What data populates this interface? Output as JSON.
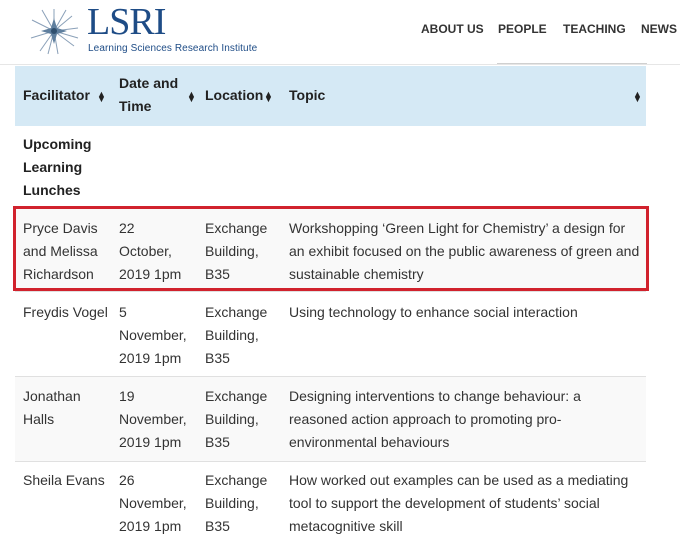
{
  "logo": {
    "title": "LSRI",
    "subtitle": "Learning Sciences Research Institute"
  },
  "nav": [
    "ABOUT US",
    "PEOPLE",
    "TEACHING",
    "NEWS"
  ],
  "table": {
    "headers": {
      "facilitator": "Facilitator",
      "date_time_1": "Date and",
      "date_time_2": "Time",
      "location": "Location",
      "topic": "Topic"
    },
    "group": [
      "Upcoming",
      "Learning",
      "Lunches"
    ],
    "rows": [
      {
        "facilitator": [
          "Pryce Davis",
          "and Melissa",
          "Richardson"
        ],
        "date": [
          "22",
          "October,",
          "2019 1pm"
        ],
        "location": [
          "Exchange",
          "Building,",
          "B35"
        ],
        "topic": [
          "Workshopping ‘Green Light for Chemistry’ a design for",
          "an exhibit focused on the public awareness of green and",
          "sustainable chemistry"
        ]
      },
      {
        "facilitator": [
          "Freydis Vogel"
        ],
        "date": [
          "5",
          "November,",
          "2019 1pm"
        ],
        "location": [
          "Exchange",
          "Building,",
          "B35"
        ],
        "topic": [
          "Using technology to enhance social interaction"
        ]
      },
      {
        "facilitator": [
          "Jonathan",
          "Halls"
        ],
        "date": [
          "19",
          "November,",
          "2019 1pm"
        ],
        "location": [
          "Exchange",
          "Building,",
          "B35"
        ],
        "topic": [
          "Designing interventions to change behaviour: a",
          "reasoned action approach to promoting pro-",
          "environmental behaviours"
        ]
      },
      {
        "facilitator": [
          "Sheila Evans"
        ],
        "date": [
          "26",
          "November,",
          "2019 1pm"
        ],
        "location": [
          "Exchange",
          "Building,",
          "B35"
        ],
        "topic": [
          "How worked out examples can be used as a mediating",
          "tool to support the development of students’ social",
          "metacognitive skill"
        ]
      }
    ]
  },
  "colors": {
    "header_bg": "#d5e9f5",
    "highlight": "#d1222d",
    "brand": "#1e4c86",
    "row_alt": "#f9f9f9"
  }
}
